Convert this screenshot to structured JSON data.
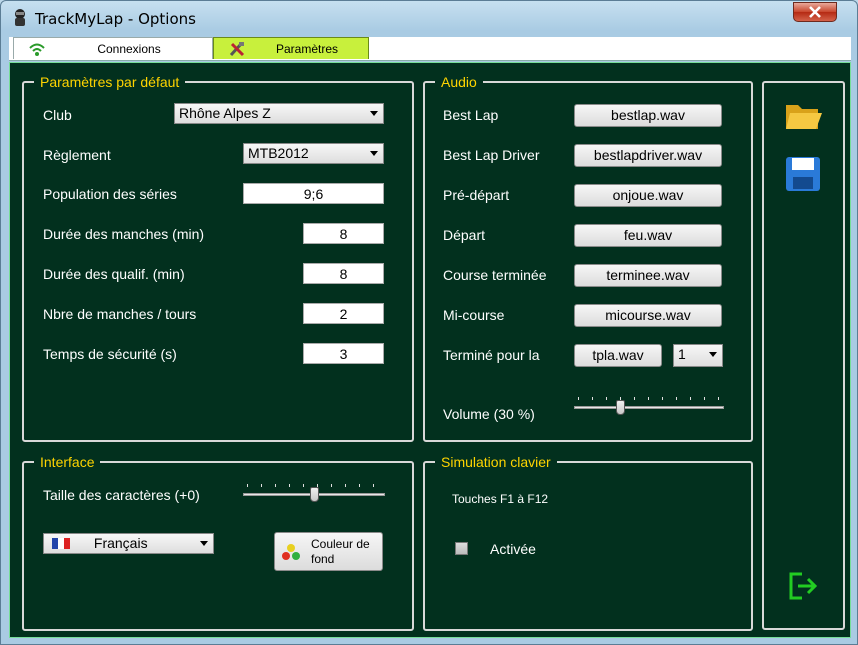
{
  "window": {
    "title": "TrackMyLap - Options"
  },
  "tabs": [
    {
      "label": "Connexions",
      "icon": "wifi-icon"
    },
    {
      "label": "Paramètres",
      "icon": "tools-icon"
    }
  ],
  "defaults": {
    "legend": "Paramètres par défaut",
    "club_label": "Club",
    "club_value": "Rhône Alpes Z",
    "reglement_label": "Règlement",
    "reglement_value": "MTB2012",
    "population_label": "Population des séries",
    "population_value": "9;6",
    "duree_manches_label": "Durée des manches (min)",
    "duree_manches_value": "8",
    "duree_qualif_label": "Durée des qualif. (min)",
    "duree_qualif_value": "8",
    "nbre_manches_label": "Nbre de manches / tours",
    "nbre_manches_value": "2",
    "temps_securite_label": "Temps de sécurité (s)",
    "temps_securite_value": "3"
  },
  "audio": {
    "legend": "Audio",
    "rows": [
      {
        "label": "Best Lap",
        "file": "bestlap.wav"
      },
      {
        "label": "Best Lap Driver",
        "file": "bestlapdriver.wav"
      },
      {
        "label": "Pré-départ",
        "file": "onjoue.wav"
      },
      {
        "label": "Départ",
        "file": "feu.wav"
      },
      {
        "label": "Course terminée",
        "file": "terminee.wav"
      },
      {
        "label": "Mi-course",
        "file": "micourse.wav"
      }
    ],
    "termine_label": "Terminé pour la",
    "termine_file": "tpla.wav",
    "termine_count": "1",
    "volume_label": "Volume (30 %)",
    "volume_fraction": 0.3
  },
  "interface": {
    "legend": "Interface",
    "font_size_label": "Taille des caractères (+0)",
    "font_size_fraction": 0.5,
    "language_value": "Français",
    "bg_color_button": "Couleur de fond"
  },
  "simulation": {
    "legend": "Simulation clavier",
    "keys_label": "Touches F1 à F12",
    "activated_label": "Activée",
    "activated": false
  },
  "sidebar": {
    "icons": [
      "folder-open-icon",
      "save-icon",
      "exit-icon"
    ]
  },
  "colors": {
    "panel_bg": "#02301e",
    "legend": "#ffd400",
    "tab_active": "#c8f03c",
    "accent_exit": "#22cc22"
  }
}
